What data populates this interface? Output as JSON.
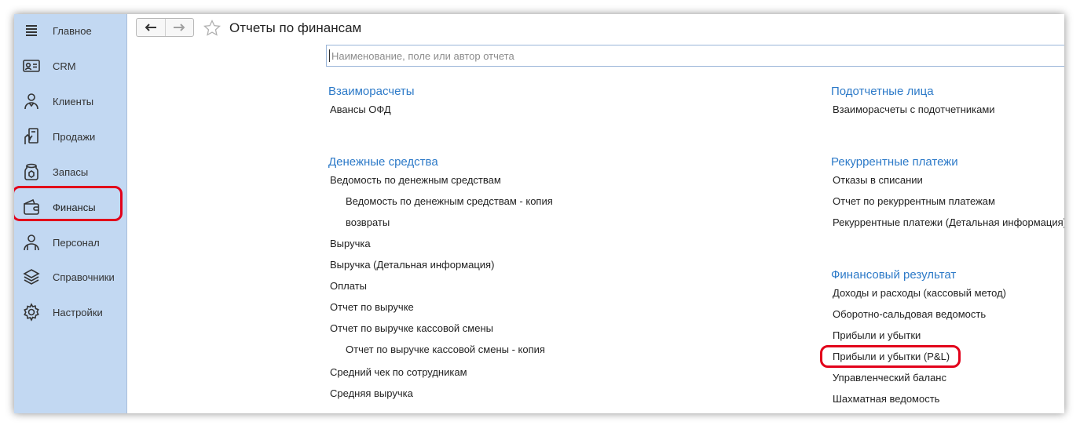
{
  "sidebar": {
    "items": [
      {
        "label": "Главное",
        "icon": "menu-lines-icon",
        "active": false
      },
      {
        "label": "CRM",
        "icon": "contact-card-icon",
        "active": false
      },
      {
        "label": "Клиенты",
        "icon": "client-person-icon",
        "active": false
      },
      {
        "label": "Продажи",
        "icon": "sales-hand-icon",
        "active": false
      },
      {
        "label": "Запасы",
        "icon": "stock-jar-icon",
        "active": false
      },
      {
        "label": "Финансы",
        "icon": "wallet-icon",
        "active": true
      },
      {
        "label": "Персонал",
        "icon": "staff-person-icon",
        "active": false
      },
      {
        "label": "Справочники",
        "icon": "layers-stack-icon",
        "active": false
      },
      {
        "label": "Настройки",
        "icon": "gear-icon",
        "active": false
      }
    ]
  },
  "header": {
    "title": "Отчеты по финансам"
  },
  "search": {
    "placeholder": "Наименование, поле или автор отчета",
    "value": ""
  },
  "left_column": {
    "vzaimoraschety": {
      "title": "Взаиморасчеты",
      "items": [
        "Авансы ОФД"
      ]
    },
    "denezhnye": {
      "title": "Денежные средства",
      "items": [
        "Ведомость по денежным средствам",
        "Ведомость по денежным средствам - копия",
        "возвраты",
        "Выручка",
        "Выручка (Детальная информация)",
        "Оплаты",
        "Отчет по выручке",
        "Отчет по выручке кассовой смены",
        "Отчет по выручке кассовой смены - копия",
        "Средний чек по сотрудникам",
        "Средняя выручка"
      ]
    }
  },
  "right_column": {
    "podotchetnye": {
      "title": "Подотчетные лица",
      "items": [
        "Взаиморасчеты с подотчетниками"
      ]
    },
    "rekurrentnye": {
      "title": "Рекуррентные платежи",
      "items": [
        "Отказы в списании",
        "Отчет по рекуррентным платежам",
        "Рекуррентные платежи (Детальная информация)"
      ]
    },
    "finresult": {
      "title": "Финансовый результат",
      "items": [
        "Доходы и расходы (кассовый метод)",
        "Оборотно-сальдовая ведомость",
        "Прибыли и убытки",
        "Прибыли и убытки (P&L)",
        "Управленческий баланс",
        "Шахматная ведомость"
      ]
    }
  },
  "colors": {
    "sidebar_bg": "#c2d8f2",
    "section_title": "#2d7ac8",
    "highlight": "#e2001a"
  }
}
